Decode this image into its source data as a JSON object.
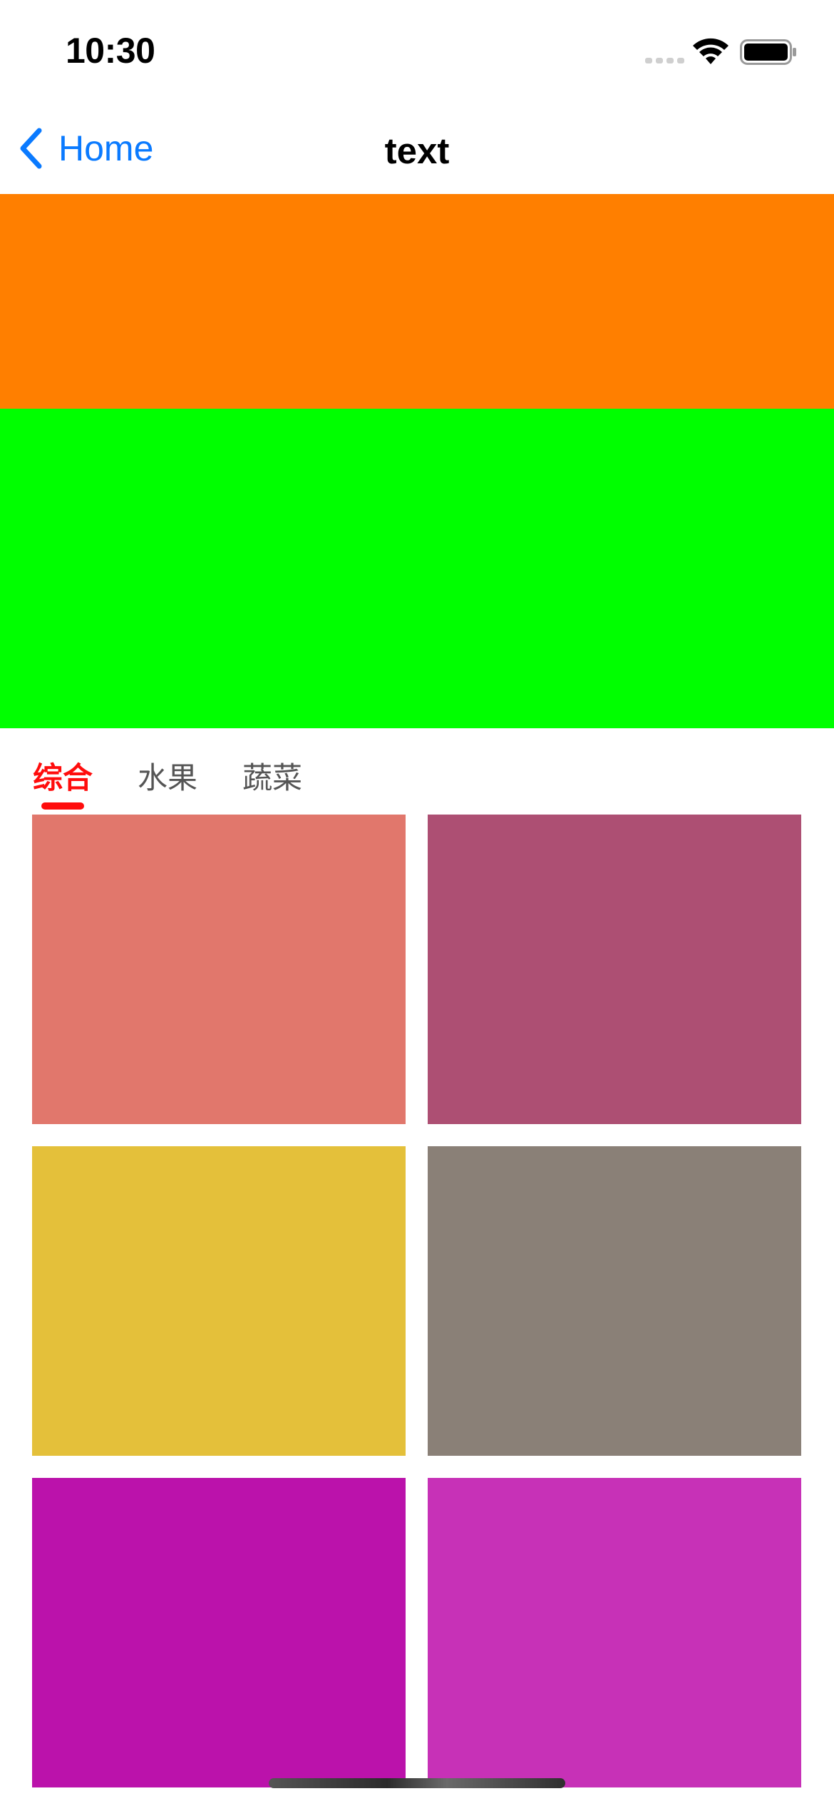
{
  "status_bar": {
    "time": "10:30",
    "icons": [
      "cellular-signal-icon",
      "wifi-icon",
      "battery-icon"
    ]
  },
  "nav": {
    "back_label": "Home",
    "back_icon": "chevron-left-icon",
    "title": "text",
    "accent_color": "#0a7aff"
  },
  "banners": [
    {
      "color": "#ff7f00"
    },
    {
      "color": "#00ff00"
    }
  ],
  "tabs": {
    "items": [
      {
        "label": "综合",
        "active": true
      },
      {
        "label": "水果",
        "active": false
      },
      {
        "label": "蔬菜",
        "active": false
      }
    ],
    "active_color": "#ff0d0d",
    "inactive_color": "#555555"
  },
  "grid": {
    "columns": 2,
    "items": [
      {
        "color": "#e1776c"
      },
      {
        "color": "#ad4f73"
      },
      {
        "color": "#e4c03a"
      },
      {
        "color": "#8a8077"
      },
      {
        "color": "#bb12ab"
      },
      {
        "color": "#c731b7"
      }
    ]
  }
}
